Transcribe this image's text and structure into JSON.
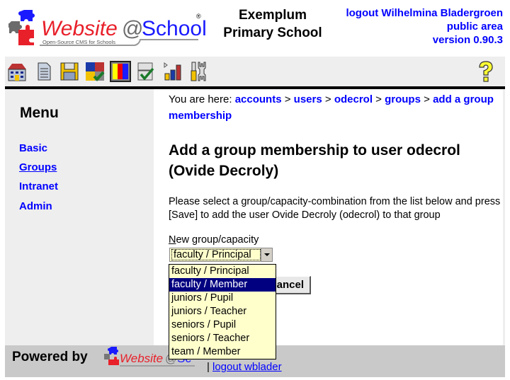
{
  "header": {
    "logo_name": "Website@School",
    "logo_tagline": "Open-Source CMS for Schools",
    "school_name_line1": "Exemplum",
    "school_name_line2": "Primary School",
    "logout_label": "logout Wilhelmina Bladergroen",
    "public_area_label": "public area",
    "version_label": "version 0.90.3"
  },
  "toolbar": {
    "icons": [
      "start-center-icon",
      "page-manager-icon",
      "file-manager-icon",
      "modules-icon",
      "account-manager-icon",
      "configuration-manager-icon",
      "statistics-icon",
      "tools-icon"
    ],
    "help_icon": "help-icon"
  },
  "sidebar": {
    "title": "Menu",
    "items": [
      {
        "label": "Basic",
        "active": false
      },
      {
        "label": "Groups",
        "active": true
      },
      {
        "label": "Intranet",
        "active": false
      },
      {
        "label": "Admin",
        "active": false
      }
    ]
  },
  "breadcrumb": {
    "prefix": "You are here:",
    "separator": ">",
    "items": [
      "accounts",
      "users",
      "odecrol",
      "groups",
      "add a group membership"
    ]
  },
  "main": {
    "title": "Add a group membership to user odecrol (Ovide Decroly)",
    "instructions": "Please select a group/capacity-combination from the list below and press [Save] to add the user Ovide Decroly (odecrol) to that group",
    "field_label_accesskey": "N",
    "field_label_rest": "ew group/capacity",
    "select_value": "faculty / Principal",
    "cancel_label": "Cancel",
    "cancel_visible_text": "ancel"
  },
  "dropdown": {
    "options": [
      {
        "label": "faculty / Principal",
        "highlighted": false
      },
      {
        "label": "faculty / Member",
        "highlighted": true
      },
      {
        "label": "juniors / Pupil",
        "highlighted": false
      },
      {
        "label": "juniors / Teacher",
        "highlighted": false
      },
      {
        "label": "seniors / Pupil",
        "highlighted": false
      },
      {
        "label": "seniors / Teacher",
        "highlighted": false
      },
      {
        "label": "team / Member",
        "highlighted": false
      }
    ]
  },
  "footer": {
    "powered_by": "Powered by",
    "separator": "|",
    "logout_link": "logout wblader"
  },
  "colors": {
    "link": "#0000ff",
    "panel_bg": "#eeeeee",
    "footer_bg": "#c9c9c9",
    "select_bg": "#ffffcc",
    "highlight": "#000080",
    "logo_red": "#e8202a",
    "logo_blue": "#1a1aff"
  }
}
